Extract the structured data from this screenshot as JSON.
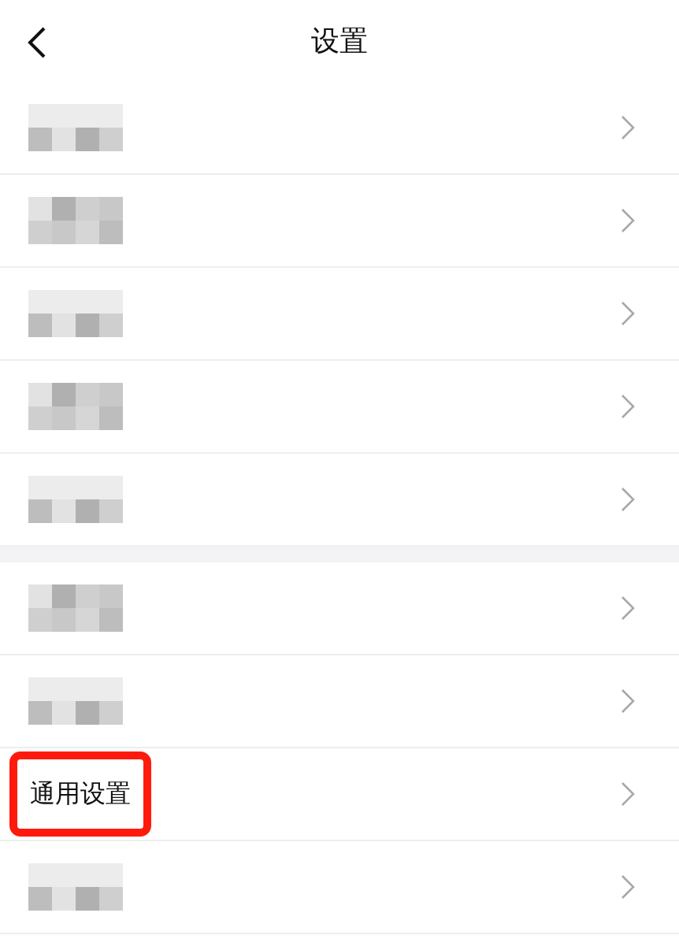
{
  "header": {
    "title": "设置"
  },
  "sections": [
    {
      "rows": [
        {
          "kind": "redacted",
          "highlighted": false
        },
        {
          "kind": "redacted",
          "highlighted": false
        },
        {
          "kind": "redacted",
          "highlighted": false
        },
        {
          "kind": "redacted",
          "highlighted": false
        },
        {
          "kind": "redacted",
          "highlighted": false
        }
      ]
    },
    {
      "rows": [
        {
          "kind": "redacted",
          "highlighted": false
        },
        {
          "kind": "redacted",
          "highlighted": false
        },
        {
          "kind": "text",
          "label": "通用设置",
          "highlighted": true
        },
        {
          "kind": "redacted",
          "highlighted": false
        }
      ]
    }
  ]
}
